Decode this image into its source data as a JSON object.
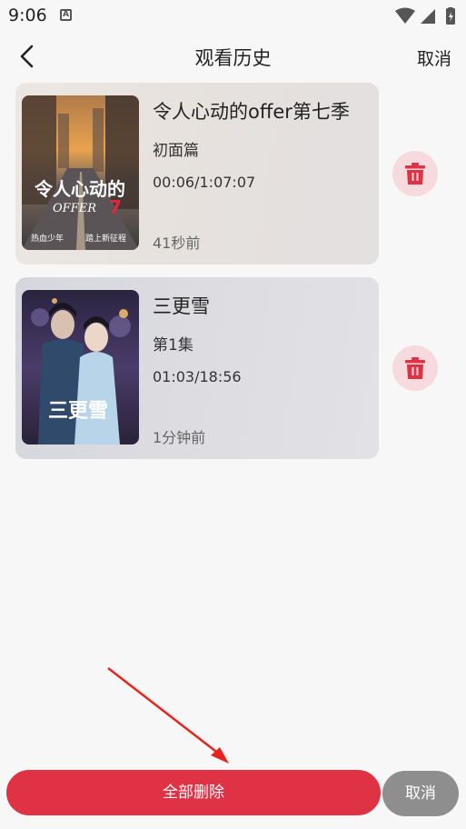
{
  "status_bar": {
    "time": "9:06",
    "icons": [
      "a-icon",
      "wifi-icon",
      "signal-icon",
      "battery-icon"
    ]
  },
  "header": {
    "title": "观看历史",
    "cancel_label": "取消",
    "back_icon": "chevron-left-icon"
  },
  "history": [
    {
      "title": "令人心动的offer第七季",
      "episode": "初面篇",
      "progress": "00:06/1:07:07",
      "time_ago": "41秒前",
      "poster_logo": "令人心动的",
      "poster_logo_sub": "OFFER",
      "poster_logo_num": "7",
      "poster_tagline_left": "热血少年",
      "poster_tagline_right": "踏上新征程"
    },
    {
      "title": "三更雪",
      "episode": "第1集",
      "progress": "01:03/18:56",
      "time_ago": "1分钟前",
      "poster_logo": "三更雪"
    }
  ],
  "footer": {
    "delete_all_label": "全部删除",
    "cancel_label": "取消"
  },
  "colors": {
    "accent_red": "#df3245",
    "delete_icon_bg": "#f6dadd",
    "cancel_gray": "#8e8e8e",
    "annotation_arrow": "#e8231f"
  }
}
